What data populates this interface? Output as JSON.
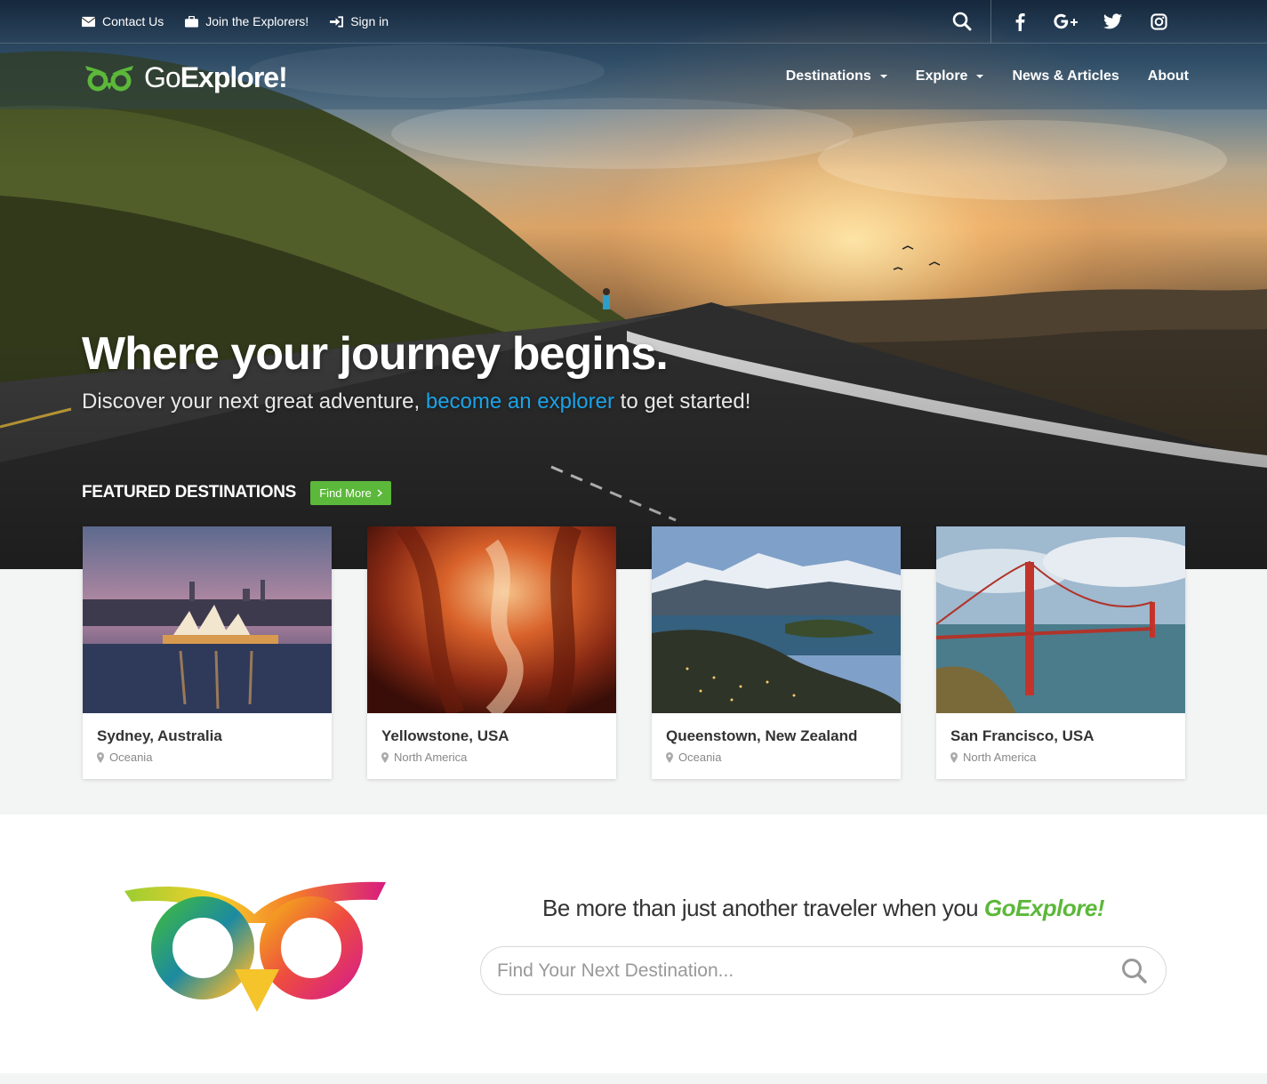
{
  "topbar": {
    "links": [
      {
        "label": "Contact Us",
        "icon": "envelope-icon"
      },
      {
        "label": "Join the Explorers!",
        "icon": "briefcase-icon"
      },
      {
        "label": "Sign in",
        "icon": "sign-in-icon"
      }
    ],
    "social": [
      "search-icon",
      "facebook-icon",
      "google-plus-icon",
      "twitter-icon",
      "instagram-icon"
    ]
  },
  "logo": {
    "prefix": "Go",
    "suffix": "Explore!"
  },
  "nav": {
    "items": [
      {
        "label": "Destinations",
        "dropdown": true
      },
      {
        "label": "Explore",
        "dropdown": true
      },
      {
        "label": "News & Articles",
        "dropdown": false
      },
      {
        "label": "About",
        "dropdown": false
      }
    ]
  },
  "hero": {
    "title": "Where your journey begins.",
    "sub_before": "Discover your next great adventure, ",
    "sub_link": "become an explorer",
    "sub_after": " to get started!"
  },
  "featured": {
    "title": "FEATURED DESTINATIONS",
    "button": "Find More",
    "cards": [
      {
        "name": "Sydney, Australia",
        "region": "Oceania"
      },
      {
        "name": "Yellowstone, USA",
        "region": "North America"
      },
      {
        "name": "Queenstown, New Zealand",
        "region": "Oceania"
      },
      {
        "name": "San Francisco, USA",
        "region": "North America"
      }
    ]
  },
  "promo": {
    "tagline_before": "Be more than just another traveler when you ",
    "tagline_brand": "GoExplore!",
    "search_placeholder": "Find Your Next Destination..."
  },
  "colors": {
    "accent_green": "#5cb83a",
    "link_blue": "#1aa3e8"
  }
}
